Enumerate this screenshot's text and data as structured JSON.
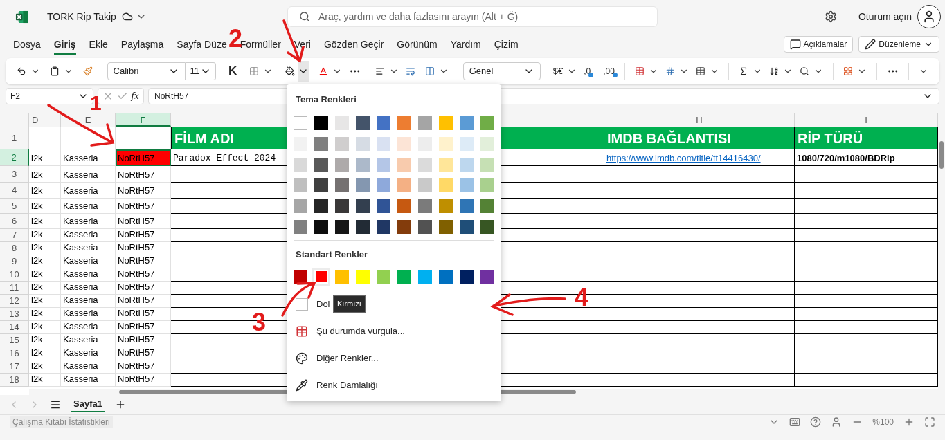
{
  "title_bar": {
    "app_title": "TORK Rip Takip",
    "search_placeholder": "Araç, yardım ve daha fazlasını arayın (Alt + Ğ)",
    "sign_in": "Oturum açın"
  },
  "menu_tabs": [
    {
      "label": "Dosya",
      "selected": false
    },
    {
      "label": "Giriş",
      "selected": true
    },
    {
      "label": "Ekle",
      "selected": false
    },
    {
      "label": "Paylaşma",
      "selected": false
    },
    {
      "label": "Sayfa Düze",
      "selected": false
    },
    {
      "label": "Formüller",
      "selected": false
    },
    {
      "label": "Veri",
      "selected": false
    },
    {
      "label": "Gözden Geçir",
      "selected": false
    },
    {
      "label": "Görünüm",
      "selected": false
    },
    {
      "label": "Yardım",
      "selected": false
    },
    {
      "label": "Çizim",
      "selected": false
    }
  ],
  "header_buttons": [
    {
      "label": "Açıklamalar",
      "kind": "comments"
    },
    {
      "label": "Düzenleme",
      "kind": "editing"
    }
  ],
  "ribbon": {
    "font_name": "Calibri",
    "font_size": "11",
    "bold_label": "K",
    "fill_menu_open": true,
    "number_format": "Genel",
    "currency": "$€",
    "decrease_decimal": ",0",
    "increase_decimal": ",00"
  },
  "formula_bar": {
    "name_box": "F2",
    "function_label": "fx",
    "value": "NoRtH57"
  },
  "grid": {
    "columns": [
      {
        "label": "D",
        "selected": false
      },
      {
        "label": "E",
        "selected": false
      },
      {
        "label": "F",
        "selected": true
      },
      {
        "selected": false
      },
      {
        "label": "H",
        "selected": false
      },
      {
        "label": "I",
        "selected": false
      }
    ],
    "rows": [
      {
        "number": "1",
        "selected": false,
        "g": "FİLM ADI",
        "h": "IMDB BAĞLANTISI",
        "i": "RİP TÜRÜ"
      },
      {
        "number": "2",
        "selected": true,
        "d": "l2k",
        "e": "Kasseria",
        "f": "NoRtH57",
        "color": "#ff0000",
        "g": "Paradox Effect 2024",
        "h": "https://www.imdb.com/title/tt14416430/",
        "i": "1080/720/m1080/BDRip"
      },
      {
        "number": "3",
        "selected": false,
        "d": "l2k",
        "e": "Kasseria",
        "f": "NoRtH57"
      },
      {
        "number": "4",
        "selected": false,
        "d": "l2k",
        "e": "Kasseria",
        "f": "NoRtH57"
      },
      {
        "number": "5",
        "selected": false,
        "d": "l2k",
        "e": "Kasseria",
        "f": "NoRtH57"
      },
      {
        "number": "6",
        "selected": false,
        "d": "l2k",
        "e": "Kasseria",
        "f": "NoRtH57"
      },
      {
        "number": "7",
        "selected": false,
        "d": "l2k",
        "e": "Kasseria",
        "f": "NoRtH57"
      },
      {
        "number": "8",
        "selected": false,
        "d": "l2k",
        "e": "Kasseria",
        "f": "NoRtH57"
      },
      {
        "number": "9",
        "selected": false,
        "d": "l2k",
        "e": "Kasseria",
        "f": "NoRtH57"
      },
      {
        "number": "10",
        "selected": false,
        "d": "l2k",
        "e": "Kasseria",
        "f": "NoRtH57"
      },
      {
        "number": "11",
        "selected": false,
        "d": "l2k",
        "e": "Kasseria",
        "f": "NoRtH57"
      },
      {
        "number": "12",
        "selected": false,
        "d": "l2k",
        "e": "Kasseria",
        "f": "NoRtH57"
      },
      {
        "number": "13",
        "selected": false,
        "d": "l2k",
        "e": "Kasseria",
        "f": "NoRtH57"
      },
      {
        "number": "14",
        "selected": false,
        "d": "l2k",
        "e": "Kasseria",
        "f": "NoRtH57"
      },
      {
        "number": "15",
        "selected": false,
        "d": "l2k",
        "e": "Kasseria",
        "f": "NoRtH57"
      },
      {
        "number": "16",
        "selected": false,
        "d": "l2k",
        "e": "Kasseria",
        "f": "NoRtH57"
      },
      {
        "number": "17",
        "selected": false,
        "d": "l2k",
        "e": "Kasseria",
        "f": "NoRtH57"
      },
      {
        "number": "18",
        "selected": false,
        "d": "l2k",
        "e": "Kasseria",
        "f": "NoRtH57"
      }
    ]
  },
  "color_menu": {
    "theme_title": "Tema Renkleri",
    "theme_rows": [
      {
        "swatches": [
          {
            "color": "#ffffff"
          },
          {
            "color": "#000000"
          },
          {
            "color": "#e7e6e6"
          },
          {
            "color": "#44546a"
          },
          {
            "color": "#4472c4"
          },
          {
            "color": "#ed7d31"
          },
          {
            "color": "#a5a5a5"
          },
          {
            "color": "#ffc000"
          },
          {
            "color": "#5b9bd5"
          },
          {
            "color": "#70ad47"
          }
        ]
      },
      {
        "swatches": [
          {
            "color": "#f2f2f2"
          },
          {
            "color": "#7f7f7f"
          },
          {
            "color": "#d0cece"
          },
          {
            "color": "#d6dce4"
          },
          {
            "color": "#d9e1f2"
          },
          {
            "color": "#fce4d6"
          },
          {
            "color": "#ededed"
          },
          {
            "color": "#fff2cc"
          },
          {
            "color": "#ddebf7"
          },
          {
            "color": "#e2efda"
          }
        ]
      },
      {
        "swatches": [
          {
            "color": "#d9d9d9"
          },
          {
            "color": "#595959"
          },
          {
            "color": "#aeaaaa"
          },
          {
            "color": "#acb9ca"
          },
          {
            "color": "#b4c6e7"
          },
          {
            "color": "#f8cbad"
          },
          {
            "color": "#dbdbdb"
          },
          {
            "color": "#ffe699"
          },
          {
            "color": "#bdd7ee"
          },
          {
            "color": "#c6e0b4"
          }
        ]
      },
      {
        "swatches": [
          {
            "color": "#bfbfbf"
          },
          {
            "color": "#404040"
          },
          {
            "color": "#757171"
          },
          {
            "color": "#8497b0"
          },
          {
            "color": "#8ea9db"
          },
          {
            "color": "#f4b084"
          },
          {
            "color": "#c9c9c9"
          },
          {
            "color": "#ffd966"
          },
          {
            "color": "#9bc2e6"
          },
          {
            "color": "#a9d08e"
          }
        ]
      },
      {
        "swatches": [
          {
            "color": "#a6a6a6"
          },
          {
            "color": "#262626"
          },
          {
            "color": "#3a3838"
          },
          {
            "color": "#333f4f"
          },
          {
            "color": "#305496"
          },
          {
            "color": "#c65911"
          },
          {
            "color": "#7b7b7b"
          },
          {
            "color": "#bf8f00"
          },
          {
            "color": "#2f75b5"
          },
          {
            "color": "#548235"
          }
        ]
      },
      {
        "swatches": [
          {
            "color": "#808080"
          },
          {
            "color": "#0d0d0d"
          },
          {
            "color": "#161616"
          },
          {
            "color": "#222b35"
          },
          {
            "color": "#203764"
          },
          {
            "color": "#833c0c"
          },
          {
            "color": "#525252"
          },
          {
            "color": "#806000"
          },
          {
            "color": "#1f4e78"
          },
          {
            "color": "#375623"
          }
        ]
      }
    ],
    "standard_title": "Standart Renkler",
    "standard_colors": [
      {
        "color": "#c00000",
        "selected": false
      },
      {
        "color": "#ff0000",
        "selected": true
      },
      {
        "color": "#ffc000",
        "selected": false
      },
      {
        "color": "#ffff00",
        "selected": false
      },
      {
        "color": "#92d050",
        "selected": false
      },
      {
        "color": "#00b050",
        "selected": false
      },
      {
        "color": "#00b0f0",
        "selected": false
      },
      {
        "color": "#0070c0",
        "selected": false
      },
      {
        "color": "#002060",
        "selected": false
      },
      {
        "color": "#7030a0",
        "selected": false
      }
    ],
    "items": [
      {
        "kind": "no_fill",
        "label": "Dol"
      },
      {
        "kind": "highlight",
        "label": "Şu durumda vurgula..."
      },
      {
        "kind": "more",
        "label": "Diğer Renkler..."
      },
      {
        "kind": "eyedropper",
        "label": "Renk Damlalığı"
      }
    ],
    "tooltip": "Kırmızı"
  },
  "annotations": [
    {
      "label": "1"
    },
    {
      "label": "2"
    },
    {
      "label": "3"
    },
    {
      "label": "4"
    }
  ],
  "sheet_tabs": [
    {
      "label": "Sayfa1",
      "selected": true
    }
  ],
  "status_bar": {
    "stats": "Çalışma Kitabı İstatistikleri",
    "zoom": "%100"
  }
}
